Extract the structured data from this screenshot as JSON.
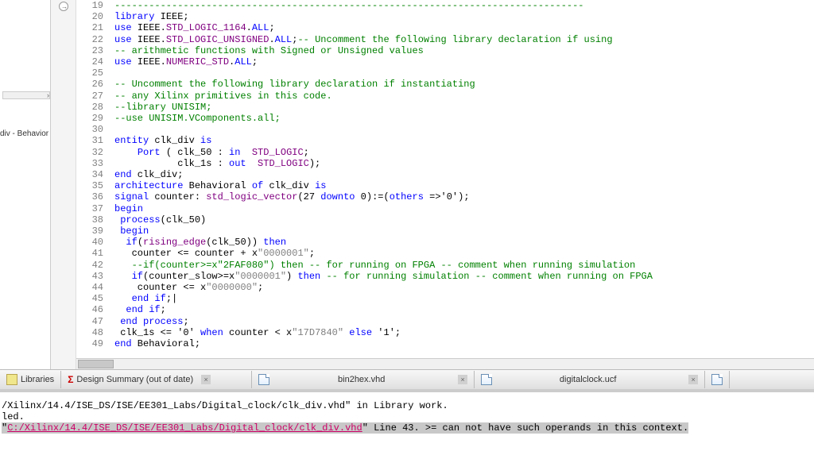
{
  "left": {
    "label": "div - Behavior"
  },
  "code": {
    "lines": [
      {
        "n": 19,
        "seg": [
          {
            "c": "cm",
            "t": "----------------------------------------------------------------------------------"
          }
        ]
      },
      {
        "n": 20,
        "seg": [
          {
            "c": "kw",
            "t": "library"
          },
          {
            "c": "id",
            "t": " IEEE;"
          }
        ]
      },
      {
        "n": 21,
        "seg": [
          {
            "c": "kw",
            "t": "use"
          },
          {
            "c": "id",
            "t": " IEEE."
          },
          {
            "c": "ty",
            "t": "STD_LOGIC_1164"
          },
          {
            "c": "id",
            "t": "."
          },
          {
            "c": "kw",
            "t": "ALL"
          },
          {
            "c": "id",
            "t": ";"
          }
        ]
      },
      {
        "n": 22,
        "seg": [
          {
            "c": "kw",
            "t": "use"
          },
          {
            "c": "id",
            "t": " IEEE."
          },
          {
            "c": "ty",
            "t": "STD_LOGIC_UNSIGNED"
          },
          {
            "c": "id",
            "t": "."
          },
          {
            "c": "kw",
            "t": "ALL"
          },
          {
            "c": "id",
            "t": ";"
          },
          {
            "c": "cm",
            "t": "-- Uncomment the following library declaration if using"
          }
        ]
      },
      {
        "n": 23,
        "seg": [
          {
            "c": "cm",
            "t": "-- arithmetic functions with Signed or Unsigned values"
          }
        ]
      },
      {
        "n": 24,
        "seg": [
          {
            "c": "kw",
            "t": "use"
          },
          {
            "c": "id",
            "t": " IEEE."
          },
          {
            "c": "ty",
            "t": "NUMERIC_STD"
          },
          {
            "c": "id",
            "t": "."
          },
          {
            "c": "kw",
            "t": "ALL"
          },
          {
            "c": "id",
            "t": ";"
          }
        ]
      },
      {
        "n": 25,
        "seg": []
      },
      {
        "n": 26,
        "seg": [
          {
            "c": "cm",
            "t": "-- Uncomment the following library declaration if instantiating"
          }
        ]
      },
      {
        "n": 27,
        "seg": [
          {
            "c": "cm",
            "t": "-- any Xilinx primitives in this code."
          }
        ]
      },
      {
        "n": 28,
        "seg": [
          {
            "c": "cm",
            "t": "--library UNISIM;"
          }
        ]
      },
      {
        "n": 29,
        "seg": [
          {
            "c": "cm",
            "t": "--use UNISIM.VComponents.all;"
          }
        ]
      },
      {
        "n": 30,
        "seg": []
      },
      {
        "n": 31,
        "seg": [
          {
            "c": "kw",
            "t": "entity"
          },
          {
            "c": "id",
            "t": " clk_div "
          },
          {
            "c": "kw",
            "t": "is"
          }
        ]
      },
      {
        "n": 32,
        "seg": [
          {
            "c": "id",
            "t": "    "
          },
          {
            "c": "kw",
            "t": "Port"
          },
          {
            "c": "id",
            "t": " ( clk_50 : "
          },
          {
            "c": "kw",
            "t": "in"
          },
          {
            "c": "id",
            "t": "  "
          },
          {
            "c": "ty",
            "t": "STD_LOGIC"
          },
          {
            "c": "id",
            "t": ";"
          }
        ]
      },
      {
        "n": 33,
        "seg": [
          {
            "c": "id",
            "t": "           clk_1s : "
          },
          {
            "c": "kw",
            "t": "out"
          },
          {
            "c": "id",
            "t": "  "
          },
          {
            "c": "ty",
            "t": "STD_LOGIC"
          },
          {
            "c": "id",
            "t": ");"
          }
        ]
      },
      {
        "n": 34,
        "seg": [
          {
            "c": "kw",
            "t": "end"
          },
          {
            "c": "id",
            "t": " clk_div;"
          }
        ]
      },
      {
        "n": 35,
        "seg": [
          {
            "c": "kw",
            "t": "architecture"
          },
          {
            "c": "id",
            "t": " Behavioral "
          },
          {
            "c": "kw",
            "t": "of"
          },
          {
            "c": "id",
            "t": " clk_div "
          },
          {
            "c": "kw",
            "t": "is"
          }
        ]
      },
      {
        "n": 36,
        "seg": [
          {
            "c": "kw",
            "t": "signal"
          },
          {
            "c": "id",
            "t": " counter: "
          },
          {
            "c": "ty",
            "t": "std_logic_vector"
          },
          {
            "c": "id",
            "t": "(27 "
          },
          {
            "c": "kw",
            "t": "downto"
          },
          {
            "c": "id",
            "t": " 0):=("
          },
          {
            "c": "kw",
            "t": "others"
          },
          {
            "c": "id",
            "t": " =>'0');"
          }
        ]
      },
      {
        "n": 37,
        "seg": [
          {
            "c": "kw",
            "t": "begin"
          }
        ]
      },
      {
        "n": 38,
        "seg": [
          {
            "c": "id",
            "t": " "
          },
          {
            "c": "kw",
            "t": "process"
          },
          {
            "c": "id",
            "t": "(clk_50)"
          }
        ]
      },
      {
        "n": 39,
        "seg": [
          {
            "c": "id",
            "t": " "
          },
          {
            "c": "kw",
            "t": "begin"
          }
        ]
      },
      {
        "n": 40,
        "seg": [
          {
            "c": "id",
            "t": "  "
          },
          {
            "c": "kw",
            "t": "if"
          },
          {
            "c": "id",
            "t": "("
          },
          {
            "c": "fn",
            "t": "rising_edge"
          },
          {
            "c": "id",
            "t": "(clk_50)) "
          },
          {
            "c": "kw",
            "t": "then"
          }
        ]
      },
      {
        "n": 41,
        "seg": [
          {
            "c": "id",
            "t": "   counter <= counter + x"
          },
          {
            "c": "st",
            "t": "\"0000001\""
          },
          {
            "c": "id",
            "t": ";"
          }
        ]
      },
      {
        "n": 42,
        "seg": [
          {
            "c": "id",
            "t": "   "
          },
          {
            "c": "cm",
            "t": "--if(counter>=x\"2FAF080\") then -- for running on FPGA -- comment when running simulation"
          }
        ]
      },
      {
        "n": 43,
        "seg": [
          {
            "c": "id",
            "t": "   "
          },
          {
            "c": "kw",
            "t": "if"
          },
          {
            "c": "id",
            "t": "(counter_slow>=x"
          },
          {
            "c": "st",
            "t": "\"0000001\""
          },
          {
            "c": "id",
            "t": ") "
          },
          {
            "c": "kw",
            "t": "then"
          },
          {
            "c": "id",
            "t": " "
          },
          {
            "c": "cm",
            "t": "-- for running simulation -- comment when running on FPGA"
          }
        ]
      },
      {
        "n": 44,
        "seg": [
          {
            "c": "id",
            "t": "    counter <= x"
          },
          {
            "c": "st",
            "t": "\"0000000\""
          },
          {
            "c": "id",
            "t": ";"
          }
        ]
      },
      {
        "n": 45,
        "seg": [
          {
            "c": "id",
            "t": "   "
          },
          {
            "c": "kw",
            "t": "end"
          },
          {
            "c": "id",
            "t": " "
          },
          {
            "c": "kw",
            "t": "if"
          },
          {
            "c": "id",
            "t": ";|"
          }
        ]
      },
      {
        "n": 46,
        "seg": [
          {
            "c": "id",
            "t": "  "
          },
          {
            "c": "kw",
            "t": "end"
          },
          {
            "c": "id",
            "t": " "
          },
          {
            "c": "kw",
            "t": "if"
          },
          {
            "c": "id",
            "t": ";"
          }
        ]
      },
      {
        "n": 47,
        "seg": [
          {
            "c": "id",
            "t": " "
          },
          {
            "c": "kw",
            "t": "end"
          },
          {
            "c": "id",
            "t": " "
          },
          {
            "c": "kw",
            "t": "process"
          },
          {
            "c": "id",
            "t": ";"
          }
        ]
      },
      {
        "n": 48,
        "seg": [
          {
            "c": "id",
            "t": " clk_1s <= '0' "
          },
          {
            "c": "kw",
            "t": "when"
          },
          {
            "c": "id",
            "t": " counter < x"
          },
          {
            "c": "st",
            "t": "\"17D7840\""
          },
          {
            "c": "id",
            "t": " "
          },
          {
            "c": "kw",
            "t": "else"
          },
          {
            "c": "id",
            "t": " '1';"
          }
        ]
      },
      {
        "n": 49,
        "seg": [
          {
            "c": "kw",
            "t": "end"
          },
          {
            "c": "id",
            "t": " Behavioral;"
          }
        ]
      }
    ]
  },
  "tabs": {
    "libraries": "Libraries",
    "summary": "Design Summary (out of date)",
    "bin2hex": "bin2hex.vhd",
    "ucf": "digitalclock.ucf"
  },
  "console": {
    "l1": "/Xilinx/14.4/ISE_DS/ISE/EE301_Labs/Digital_clock/clk_div.vhd\" in Library work.",
    "l2": "led.",
    "l3a": "\"",
    "l3link": "C:/Xilinx/14.4/ISE_DS/ISE/EE301_Labs/Digital_clock/clk_div.vhd",
    "l3b": "\" Line 43. >= can not have such operands in this context."
  }
}
